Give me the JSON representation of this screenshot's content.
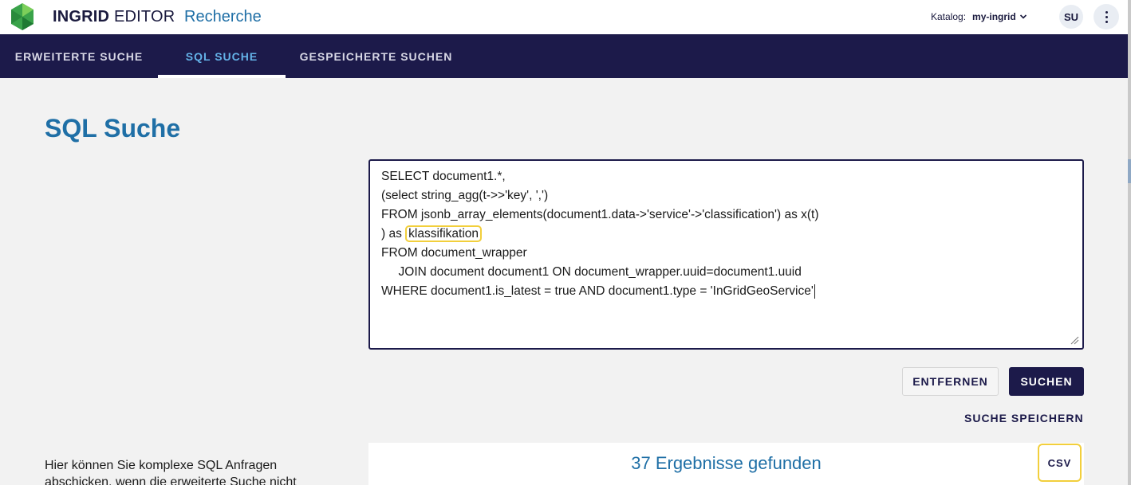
{
  "header": {
    "brand_bold": "INGRID",
    "brand_light": "EDITOR",
    "page_name": "Recherche",
    "catalog_label": "Katalog:",
    "catalog_value": "my-ingrid",
    "user_initials": "SU",
    "logo_icon": "ingrid-leaf-logo",
    "more_icon": "more-vert-icon"
  },
  "nav": {
    "tabs": [
      {
        "label": "ERWEITERTE SUCHE",
        "active": false
      },
      {
        "label": "SQL SUCHE",
        "active": true
      },
      {
        "label": "GESPEICHERTE SUCHEN",
        "active": false
      }
    ]
  },
  "page": {
    "title": "SQL Suche",
    "help_text": "Hier können Sie komplexe SQL Anfragen abschicken, wenn die erweiterte Suche nicht"
  },
  "query": {
    "lines": [
      "SELECT document1.*,",
      "(select string_agg(t->>'key', ',')",
      "FROM jsonb_array_elements(document1.data->'service'->'classification') as x(t)",
      ") as ",
      "FROM document_wrapper",
      "     JOIN document document1 ON document_wrapper.uuid=document1.uuid",
      "WHERE document1.is_latest = true AND document1.type = 'InGridGeoService'"
    ],
    "highlighted_word": "klassifikation"
  },
  "actions": {
    "remove_label": "ENTFERNEN",
    "search_label": "SUCHEN",
    "save_label": "SUCHE SPEICHERN",
    "csv_label": "CSV"
  },
  "results": {
    "count_text": "37 Ergebnisse gefunden"
  },
  "colors": {
    "nav_bg": "#1c1a4a",
    "accent": "#1f6fa6",
    "active_tab": "#64b2e8",
    "highlight": "#f2cf3c"
  }
}
